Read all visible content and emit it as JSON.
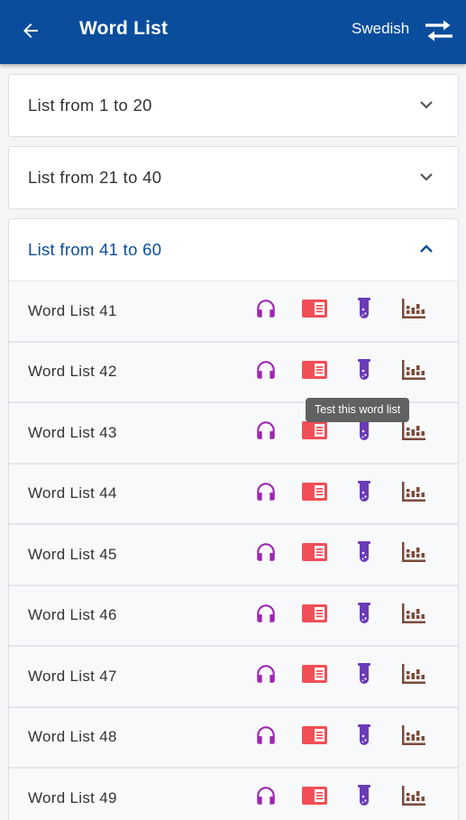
{
  "appbar": {
    "title": "Word List",
    "language": "Swedish",
    "color": "#0a4d9c"
  },
  "panels": [
    {
      "title": "List from 1 to 20",
      "expanded": false
    },
    {
      "title": "List from 21 to 40",
      "expanded": false
    },
    {
      "title": "List from 41 to 60",
      "expanded": true
    }
  ],
  "lists": [
    {
      "label": "Word List 41"
    },
    {
      "label": "Word List 42"
    },
    {
      "label": "Word List 43"
    },
    {
      "label": "Word List 44"
    },
    {
      "label": "Word List 45"
    },
    {
      "label": "Word List 46"
    },
    {
      "label": "Word List 47"
    },
    {
      "label": "Word List 48"
    },
    {
      "label": "Word List 49"
    }
  ],
  "row_icons": [
    "headphones-icon",
    "book-icon",
    "test-tube-icon",
    "stats-chart-icon"
  ],
  "icon_colors": {
    "headphones": "#9c27b0",
    "book": "#f04f56",
    "test_tube": "#6a3bb8",
    "stats": "#7b4a3a"
  },
  "tooltip": {
    "text": "Test this word list"
  }
}
